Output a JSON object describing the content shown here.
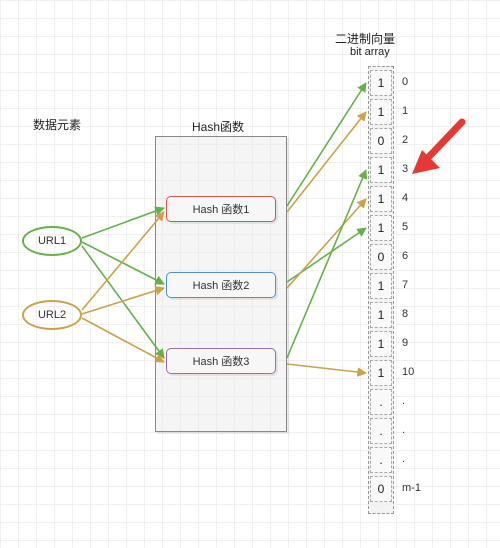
{
  "titles": {
    "bit_array_cn": "二进制向量",
    "bit_array_en": "bit array",
    "data_elements": "数据元素",
    "hash_functions": "Hash函数"
  },
  "inputs": [
    {
      "name": "url1",
      "label": "URL1",
      "color": "#66b04a"
    },
    {
      "name": "url2",
      "label": "URL2",
      "color": "#cba14a"
    }
  ],
  "hash_fns": [
    {
      "id": 1,
      "label": "Hash 函数1",
      "border": "#d9534f"
    },
    {
      "id": 2,
      "label": "Hash 函数2",
      "border": "#4a8fd8"
    },
    {
      "id": 3,
      "label": "Hash 函数3",
      "border": "#9a6db0"
    }
  ],
  "bit_array": {
    "cells": [
      {
        "idx": "0",
        "val": "1"
      },
      {
        "idx": "1",
        "val": "1"
      },
      {
        "idx": "2",
        "val": "0"
      },
      {
        "idx": "3",
        "val": "1"
      },
      {
        "idx": "4",
        "val": "1"
      },
      {
        "idx": "5",
        "val": "1"
      },
      {
        "idx": "6",
        "val": "0"
      },
      {
        "idx": "7",
        "val": "1"
      },
      {
        "idx": "8",
        "val": "1"
      },
      {
        "idx": "9",
        "val": "1"
      },
      {
        "idx": "10",
        "val": "1"
      },
      {
        "idx": ".",
        "val": "."
      },
      {
        "idx": ".",
        "val": "."
      },
      {
        "idx": ".",
        "val": "."
      },
      {
        "idx": "m-1",
        "val": "0"
      }
    ]
  },
  "arrows": {
    "url1_to_h1": {
      "color": "#66b04a"
    },
    "url1_to_h2": {
      "color": "#66b04a"
    },
    "url1_to_h3": {
      "color": "#66b04a"
    },
    "url2_to_h1": {
      "color": "#cba14a"
    },
    "url2_to_h2": {
      "color": "#cba14a"
    },
    "url2_to_h3": {
      "color": "#cba14a"
    },
    "h1_u1_out": {
      "color": "#66b04a",
      "target_idx": 0
    },
    "h2_u1_out": {
      "color": "#66b04a",
      "target_idx": 5
    },
    "h3_u1_out": {
      "color": "#66b04a",
      "target_idx": 3
    },
    "h1_u2_out": {
      "color": "#cba14a",
      "target_idx": 1
    },
    "h2_u2_out": {
      "color": "#cba14a",
      "target_idx": 4
    },
    "h3_u2_out": {
      "color": "#cba14a",
      "target_idx": 10
    },
    "red_pointer": {
      "color": "#e53935",
      "target_idx": 3
    }
  }
}
